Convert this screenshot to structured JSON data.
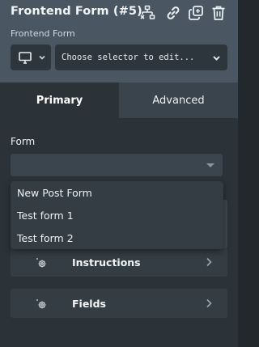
{
  "header": {
    "title": "Frontend Form (#5)",
    "subtitle": "Frontend Form",
    "actions": [
      {
        "name": "structure",
        "icon": "sitemap-icon"
      },
      {
        "name": "link",
        "icon": "link-icon"
      },
      {
        "name": "clone",
        "icon": "clone-icon"
      },
      {
        "name": "delete",
        "icon": "trash-icon"
      }
    ],
    "device_icon": "desktop-icon",
    "selector": {
      "placeholder": "Choose selector to edit..."
    }
  },
  "tabs": [
    {
      "label": "Primary",
      "active": true
    },
    {
      "label": "Advanced",
      "active": false
    }
  ],
  "form_field": {
    "label": "Form",
    "value": "",
    "options": [
      "New Post Form",
      "Test form 1",
      "Test form 2"
    ]
  },
  "sections": [
    {
      "label": "Instructions",
      "icon": "gear-icon"
    },
    {
      "label": "Fields",
      "icon": "gear-icon"
    }
  ],
  "colors": {
    "header_bg": "#4a5762",
    "panel_bg": "#2c3338",
    "tab_inactive_bg": "#3a444c",
    "text": "#eef1f4"
  }
}
